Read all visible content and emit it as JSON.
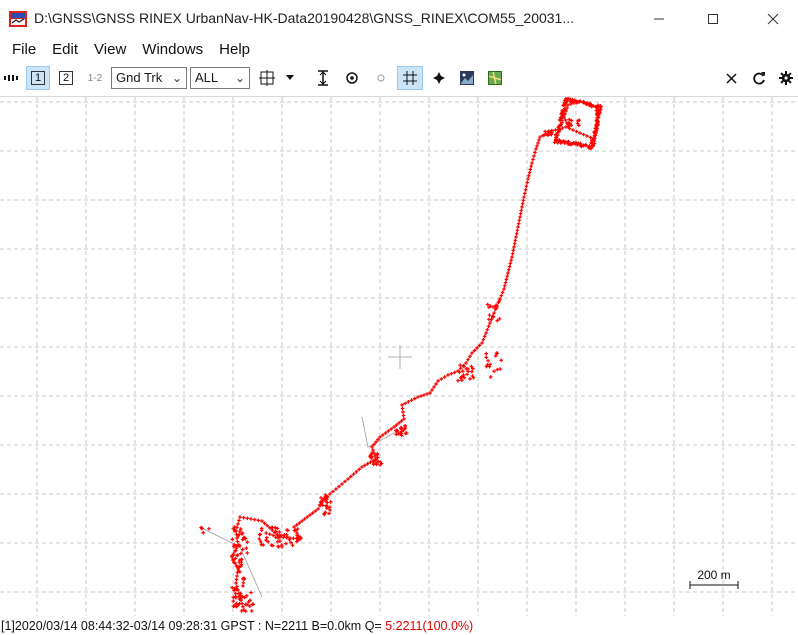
{
  "window": {
    "title": "D:\\GNSS\\GNSS RINEX UrbanNav-HK-Data20190428\\GNSS_RINEX\\COM55_20031..."
  },
  "menu": [
    "File",
    "Edit",
    "View",
    "Windows",
    "Help"
  ],
  "toolbar": {
    "btn1": "1",
    "btn2": "2",
    "btn12": "1-2",
    "plot_type": "Gnd Trk",
    "sat_filter": "ALL"
  },
  "plot": {
    "scale_label": "200 m",
    "track_color": "#ff0000",
    "grid_color": "#c8c8c8"
  },
  "status": {
    "prefix": "[1]2020/03/14 08:44:32-03/14 09:28:31 GPST : N=2211 B=0.0km Q= ",
    "quality": "5:2211(100.0%)"
  },
  "icons": [
    "minimize-icon",
    "maximize-icon",
    "close-icon",
    "pause-icon",
    "center-icon",
    "vertical-range-icon",
    "origin-icon",
    "dot-icon",
    "grid-icon",
    "point-icon",
    "image-icon",
    "map-icon",
    "clear-icon",
    "refresh-icon",
    "settings-icon"
  ]
}
